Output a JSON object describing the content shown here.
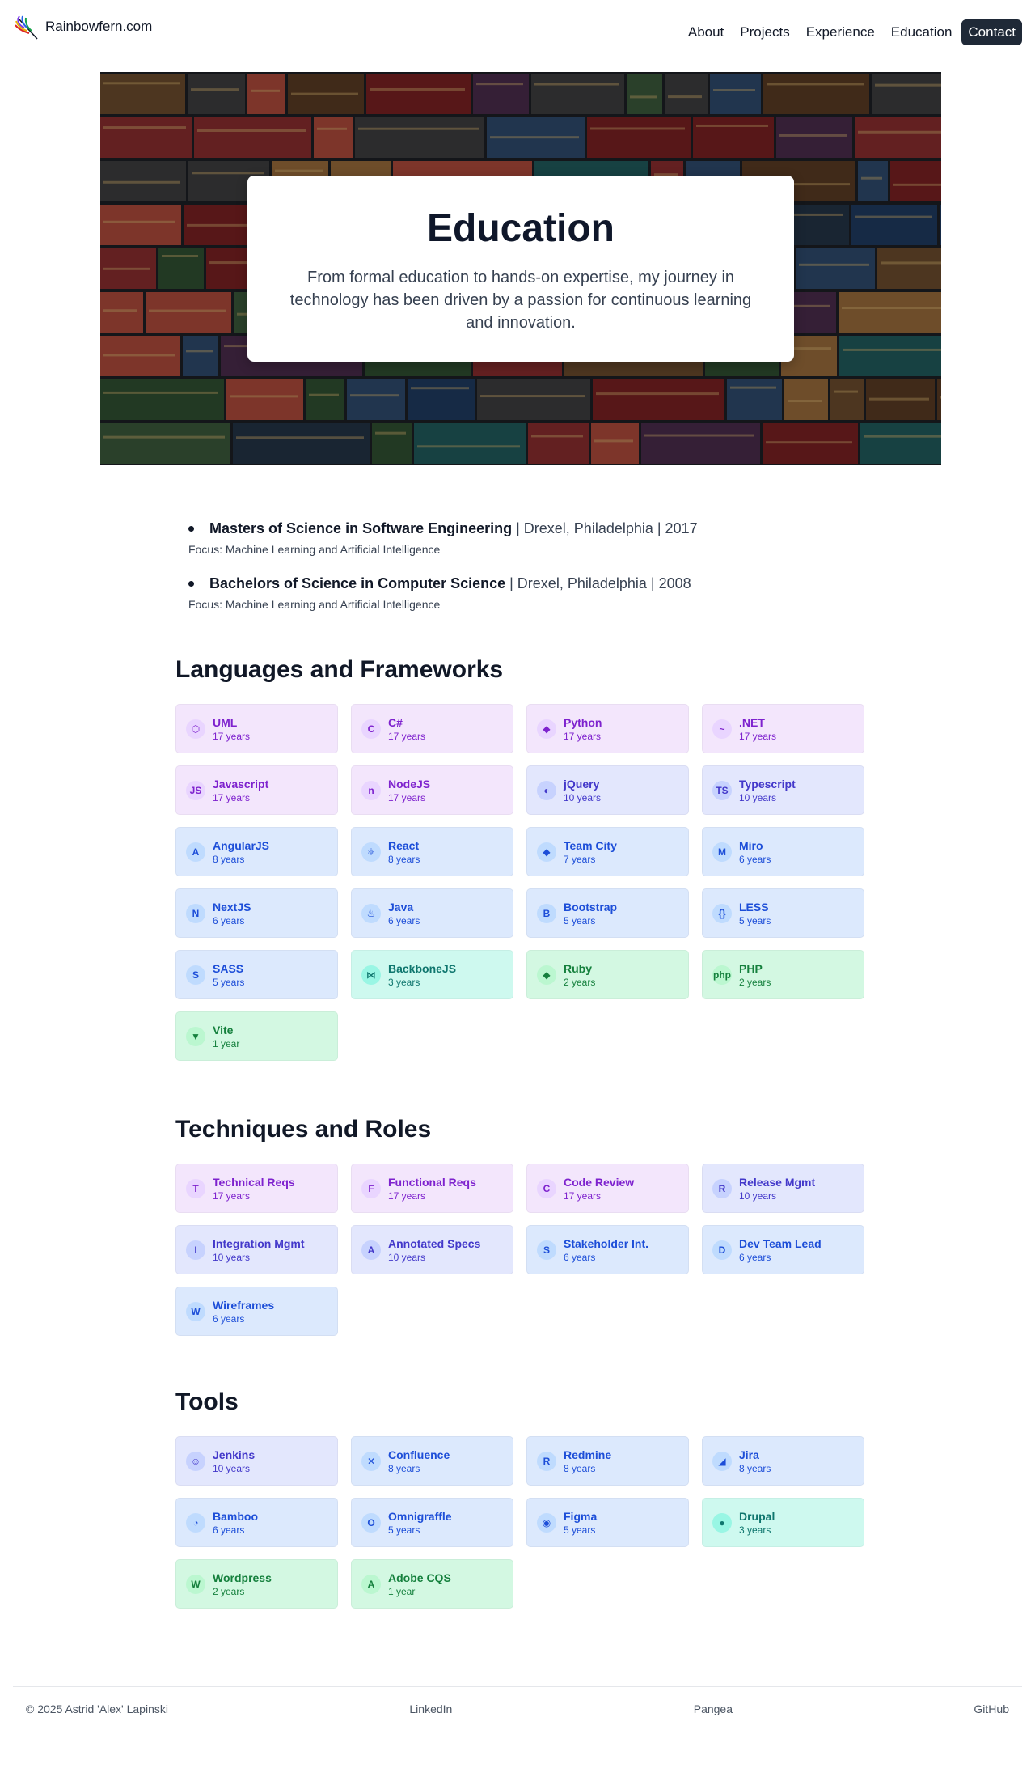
{
  "header": {
    "site_name": "Rainbowfern.com",
    "nav": [
      {
        "label": "About"
      },
      {
        "label": "Projects"
      },
      {
        "label": "Experience"
      },
      {
        "label": "Education"
      },
      {
        "label": "Contact",
        "highlight": true
      }
    ]
  },
  "hero": {
    "title": "Education",
    "subtitle": "From formal education to hands-on expertise, my journey in technology has been driven by a passion for continuous learning and innovation."
  },
  "degrees": [
    {
      "degree": "Masters of Science in Software Engineering",
      "details": " | Drexel, Philadelphia | 2017",
      "focus": "Focus: Machine Learning and Artificial Intelligence"
    },
    {
      "degree": "Bachelors of Science in Computer Science",
      "details": " | Drexel, Philadelphia | 2008",
      "focus": "Focus: Machine Learning and Artificial Intelligence"
    }
  ],
  "sections": [
    {
      "title": "Languages and Frameworks",
      "items": [
        {
          "name": "UML",
          "years": "17 years",
          "color": "purple",
          "icon": "uml-icon",
          "glyph": "⬡"
        },
        {
          "name": "C#",
          "years": "17 years",
          "color": "purple",
          "icon": "csharp-icon",
          "glyph": "C"
        },
        {
          "name": "Python",
          "years": "17 years",
          "color": "purple",
          "icon": "python-icon",
          "glyph": "◆"
        },
        {
          "name": ".NET",
          "years": "17 years",
          "color": "purple",
          "icon": "dotnet-icon",
          "glyph": "~"
        },
        {
          "name": "Javascript",
          "years": "17 years",
          "color": "purple",
          "icon": "javascript-icon",
          "glyph": "JS"
        },
        {
          "name": "NodeJS",
          "years": "17 years",
          "color": "purple",
          "icon": "nodejs-icon",
          "glyph": "n"
        },
        {
          "name": "jQuery",
          "years": "10 years",
          "color": "indigo",
          "icon": "jquery-icon",
          "glyph": "◐"
        },
        {
          "name": "Typescript",
          "years": "10 years",
          "color": "indigo",
          "icon": "typescript-icon",
          "glyph": "TS"
        },
        {
          "name": "AngularJS",
          "years": "8 years",
          "color": "blue",
          "icon": "angular-icon",
          "glyph": "A"
        },
        {
          "name": "React",
          "years": "8 years",
          "color": "blue",
          "icon": "react-icon",
          "glyph": "⚛"
        },
        {
          "name": "Team City",
          "years": "7 years",
          "color": "blue",
          "icon": "teamcity-icon",
          "glyph": "◆"
        },
        {
          "name": "Miro",
          "years": "6 years",
          "color": "blue",
          "icon": "miro-icon",
          "glyph": "M"
        },
        {
          "name": "NextJS",
          "years": "6 years",
          "color": "blue",
          "icon": "nextjs-icon",
          "glyph": "N"
        },
        {
          "name": "Java",
          "years": "6 years",
          "color": "blue",
          "icon": "java-icon",
          "glyph": "♨"
        },
        {
          "name": "Bootstrap",
          "years": "5 years",
          "color": "blue",
          "icon": "bootstrap-icon",
          "glyph": "B"
        },
        {
          "name": "LESS",
          "years": "5 years",
          "color": "blue",
          "icon": "less-icon",
          "glyph": "{}"
        },
        {
          "name": "SASS",
          "years": "5 years",
          "color": "blue",
          "icon": "sass-icon",
          "glyph": "S"
        },
        {
          "name": "BackboneJS",
          "years": "3 years",
          "color": "teal",
          "icon": "backbone-icon",
          "glyph": "⋈"
        },
        {
          "name": "Ruby",
          "years": "2 years",
          "color": "green",
          "icon": "ruby-icon",
          "glyph": "◆"
        },
        {
          "name": "PHP",
          "years": "2 years",
          "color": "green",
          "icon": "php-icon",
          "glyph": "php"
        },
        {
          "name": "Vite",
          "years": "1 year",
          "color": "green",
          "icon": "vite-icon",
          "glyph": "▼"
        }
      ]
    },
    {
      "title": "Techniques and Roles",
      "items": [
        {
          "name": "Technical Reqs",
          "years": "17 years",
          "color": "purple",
          "icon": "letter-t-icon",
          "glyph": "T"
        },
        {
          "name": "Functional Reqs",
          "years": "17 years",
          "color": "purple",
          "icon": "letter-f-icon",
          "glyph": "F"
        },
        {
          "name": "Code Review",
          "years": "17 years",
          "color": "purple",
          "icon": "letter-c-icon",
          "glyph": "C"
        },
        {
          "name": "Release Mgmt",
          "years": "10 years",
          "color": "indigo",
          "icon": "letter-r-icon",
          "glyph": "R"
        },
        {
          "name": "Integration Mgmt",
          "years": "10 years",
          "color": "indigo",
          "icon": "letter-i-icon",
          "glyph": "I"
        },
        {
          "name": "Annotated Specs",
          "years": "10 years",
          "color": "indigo",
          "icon": "letter-a-icon",
          "glyph": "A"
        },
        {
          "name": "Stakeholder Int.",
          "years": "6 years",
          "color": "blue",
          "icon": "letter-s-icon",
          "glyph": "S"
        },
        {
          "name": "Dev Team Lead",
          "years": "6 years",
          "color": "blue",
          "icon": "letter-d-icon",
          "glyph": "D"
        },
        {
          "name": "Wireframes",
          "years": "6 years",
          "color": "blue",
          "icon": "letter-w-icon",
          "glyph": "W"
        }
      ]
    },
    {
      "title": "Tools",
      "items": [
        {
          "name": "Jenkins",
          "years": "10 years",
          "color": "indigo",
          "icon": "jenkins-icon",
          "glyph": "☺"
        },
        {
          "name": "Confluence",
          "years": "8 years",
          "color": "blue",
          "icon": "confluence-icon",
          "glyph": "✕"
        },
        {
          "name": "Redmine",
          "years": "8 years",
          "color": "blue",
          "icon": "letter-r-icon",
          "glyph": "R"
        },
        {
          "name": "Jira",
          "years": "8 years",
          "color": "blue",
          "icon": "jira-icon",
          "glyph": "◢"
        },
        {
          "name": "Bamboo",
          "years": "6 years",
          "color": "blue",
          "icon": "bamboo-icon",
          "glyph": "◔"
        },
        {
          "name": "Omnigraffle",
          "years": "5 years",
          "color": "blue",
          "icon": "letter-o-icon",
          "glyph": "O"
        },
        {
          "name": "Figma",
          "years": "5 years",
          "color": "blue",
          "icon": "figma-icon",
          "glyph": "◉"
        },
        {
          "name": "Drupal",
          "years": "3 years",
          "color": "teal",
          "icon": "drupal-icon",
          "glyph": "●"
        },
        {
          "name": "Wordpress",
          "years": "2 years",
          "color": "green",
          "icon": "wordpress-icon",
          "glyph": "W"
        },
        {
          "name": "Adobe CQS",
          "years": "1 year",
          "color": "green",
          "icon": "letter-a-icon",
          "glyph": "A"
        }
      ]
    }
  ],
  "footer": {
    "copyright": "© 2025 Astrid 'Alex' Lapinski",
    "links": [
      {
        "label": "LinkedIn"
      },
      {
        "label": "Pangea"
      },
      {
        "label": "GitHub"
      }
    ]
  }
}
